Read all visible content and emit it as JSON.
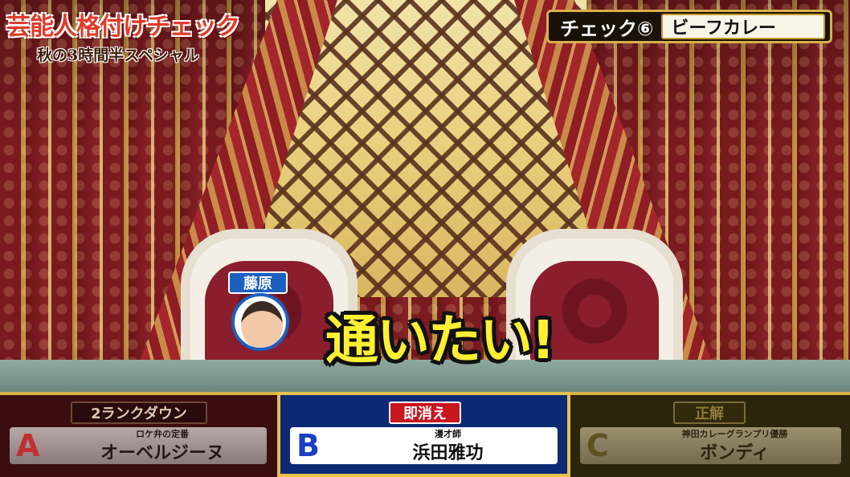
{
  "title": {
    "main": "芸能人格付けチェック",
    "sub": "秋の3時間半スペシャル"
  },
  "check": {
    "label": "チェック⑥",
    "name": "ビーフカレー"
  },
  "speaker": {
    "name": "藤原",
    "speech": "通いたい!"
  },
  "options": [
    {
      "tag": "2ランクダウン",
      "letter": "A",
      "caption": "ロケ弁の定番",
      "name": "オーベルジーヌ"
    },
    {
      "tag": "即消え",
      "letter": "B",
      "caption": "漫才師",
      "name": "浜田雅功"
    },
    {
      "tag": "正解",
      "letter": "C",
      "caption": "神田カレーグランプリ優勝",
      "name": "ボンディ"
    }
  ],
  "colors": {
    "accent_gold": "#d7b04a",
    "option_b_bg": "#0b2a73",
    "speech_yellow": "#fff032",
    "tag_red": "#c8161e"
  }
}
